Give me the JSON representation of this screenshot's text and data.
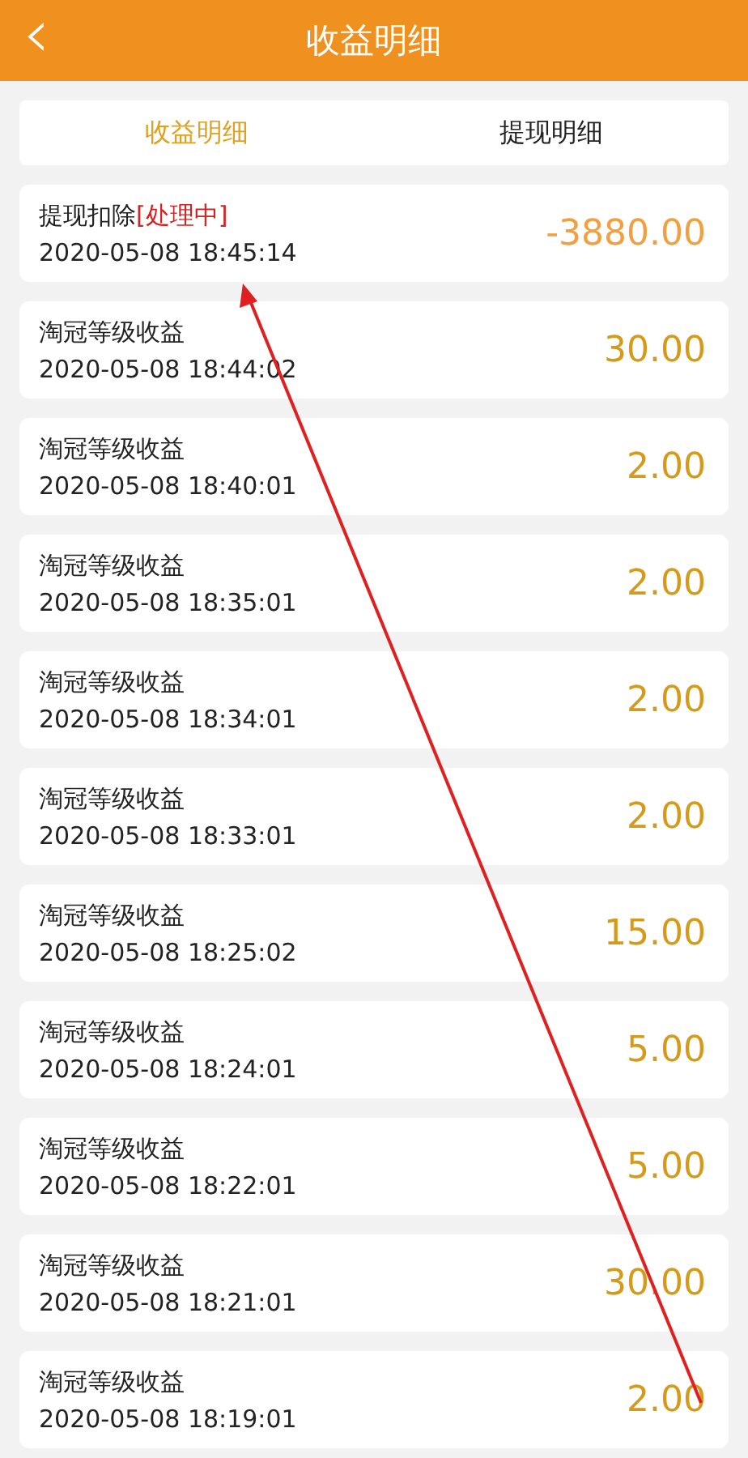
{
  "header": {
    "back_icon": "‹",
    "title": "收益明细"
  },
  "tabs": [
    {
      "label": "收益明细",
      "selected": true
    },
    {
      "label": "提现明细",
      "selected": false
    }
  ],
  "records": [
    {
      "kind": "withdrawal",
      "title": "提现扣除",
      "status": "[处理中]",
      "time": "2020-05-08 18:45:14",
      "amount": "-3880.00"
    },
    {
      "kind": "income",
      "title": "淘冠等级收益",
      "time": "2020-05-08 18:44:02",
      "amount": "30.00"
    },
    {
      "kind": "income",
      "title": "淘冠等级收益",
      "time": "2020-05-08 18:40:01",
      "amount": "2.00"
    },
    {
      "kind": "income",
      "title": "淘冠等级收益",
      "time": "2020-05-08 18:35:01",
      "amount": "2.00"
    },
    {
      "kind": "income",
      "title": "淘冠等级收益",
      "time": "2020-05-08 18:34:01",
      "amount": "2.00"
    },
    {
      "kind": "income",
      "title": "淘冠等级收益",
      "time": "2020-05-08 18:33:01",
      "amount": "2.00"
    },
    {
      "kind": "income",
      "title": "淘冠等级收益",
      "time": "2020-05-08 18:25:02",
      "amount": "15.00"
    },
    {
      "kind": "income",
      "title": "淘冠等级收益",
      "time": "2020-05-08 18:24:01",
      "amount": "5.00"
    },
    {
      "kind": "income",
      "title": "淘冠等级收益",
      "time": "2020-05-08 18:22:01",
      "amount": "5.00"
    },
    {
      "kind": "income",
      "title": "淘冠等级收益",
      "time": "2020-05-08 18:21:01",
      "amount": "30.00"
    },
    {
      "kind": "income",
      "title": "淘冠等级收益",
      "time": "2020-05-08 18:19:01",
      "amount": "2.00"
    }
  ]
}
